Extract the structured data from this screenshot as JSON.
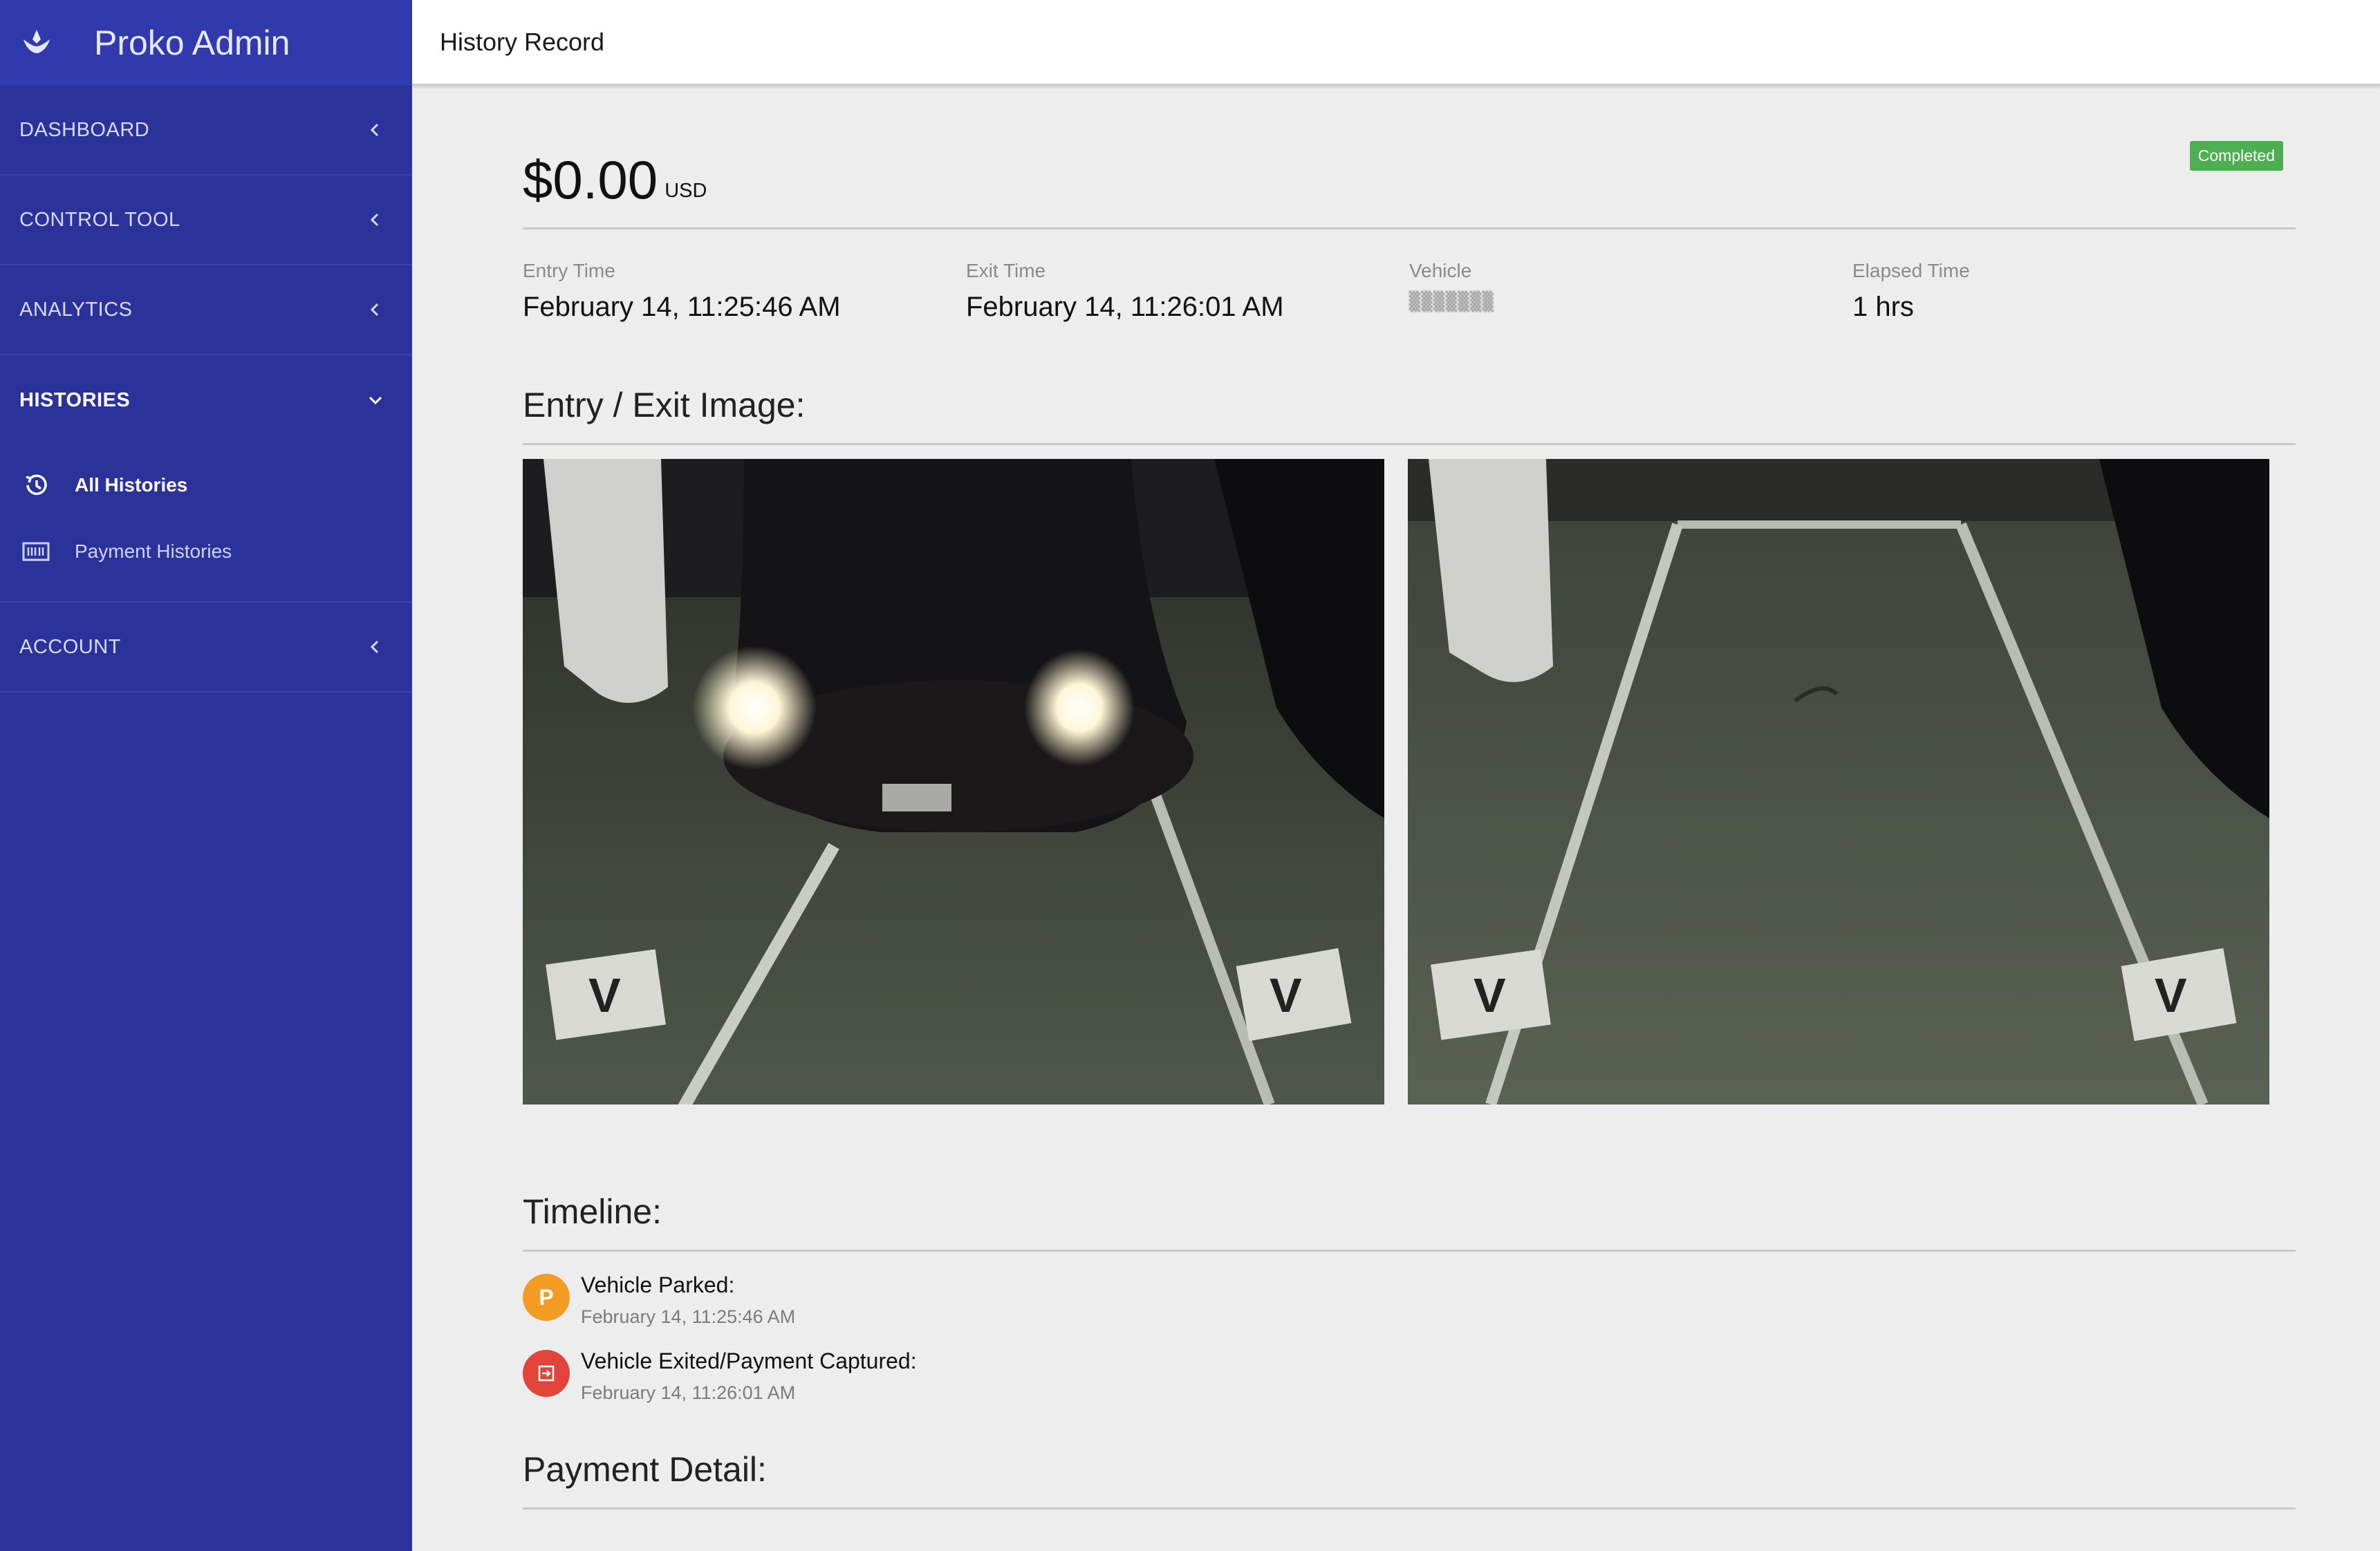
{
  "app": {
    "brand": "Proko Admin"
  },
  "sidebar": {
    "items": [
      {
        "label": "DASHBOARD"
      },
      {
        "label": "CONTROL TOOL"
      },
      {
        "label": "ANALYTICS"
      },
      {
        "label": "HISTORIES",
        "expanded": true
      },
      {
        "label": "ACCOUNT"
      }
    ],
    "histories_sub": [
      {
        "label": "All Histories",
        "icon": "history-icon",
        "active": true
      },
      {
        "label": "Payment Histories",
        "icon": "receipt-icon"
      }
    ]
  },
  "header": {
    "title": "History Record"
  },
  "record": {
    "status": "Completed",
    "amount": "$0.00",
    "currency": "USD",
    "entry_label": "Entry Time",
    "entry_value": "February 14, 11:25:46 AM",
    "exit_label": "Exit Time",
    "exit_value": "February 14, 11:26:01 AM",
    "vehicle_label": "Vehicle",
    "vehicle_value": "▒▒▒▒▒▒▒",
    "elapsed_label": "Elapsed Time",
    "elapsed_value": "1 hrs"
  },
  "sections": {
    "images_title": "Entry / Exit Image:",
    "timeline_title": "Timeline:",
    "payment_title": "Payment Detail:"
  },
  "timeline": [
    {
      "icon_text": "P",
      "label": "Vehicle Parked:",
      "time": "February 14, 11:25:46 AM",
      "color": "#f39b22"
    },
    {
      "icon_text": "⇥",
      "label": "Vehicle Exited/Payment Captured:",
      "time": "February 14, 11:26:01 AM",
      "color": "#e2443a"
    }
  ],
  "colors": {
    "sidebar": "#2b339a",
    "brand_bar": "#303aad",
    "badge": "#4caf50"
  }
}
